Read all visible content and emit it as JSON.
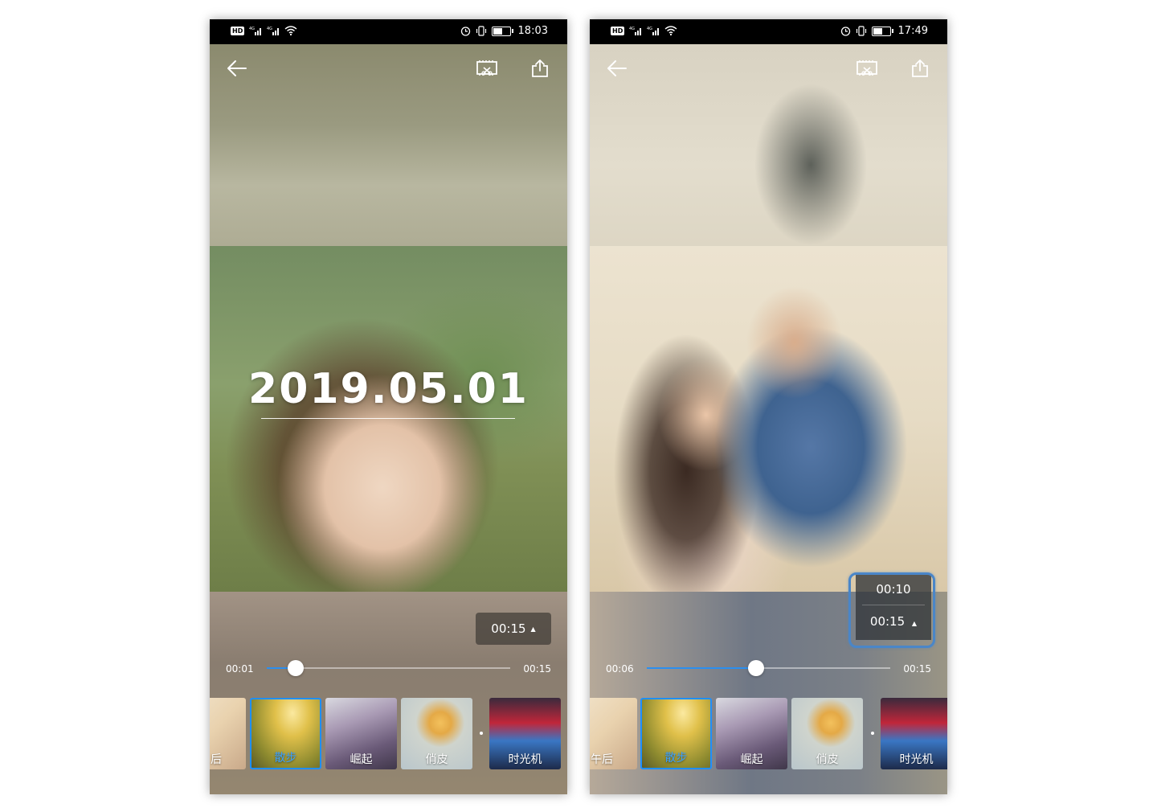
{
  "screens": [
    {
      "status": {
        "time": "18:03"
      },
      "date_title": "2019.05.01",
      "duration_button": {
        "label": "00:15",
        "arrow": "▲"
      },
      "player": {
        "current": "00:01",
        "total": "00:15",
        "progress": 0.12
      },
      "filters": [
        {
          "label": "后",
          "selected": false
        },
        {
          "label": "散步",
          "selected": true
        },
        {
          "label": "崛起",
          "selected": false
        },
        {
          "label": "俏皮",
          "selected": false
        },
        {
          "label": "时光机",
          "selected": false
        }
      ]
    },
    {
      "status": {
        "time": "17:49"
      },
      "duration_menu": {
        "option_1": "00:10",
        "option_2": "00:15",
        "arrow": "▲"
      },
      "player": {
        "current": "00:06",
        "total": "00:15",
        "progress": 0.45
      },
      "filters": [
        {
          "label": "午后",
          "selected": false
        },
        {
          "label": "散步",
          "selected": true
        },
        {
          "label": "崛起",
          "selected": false
        },
        {
          "label": "俏皮",
          "selected": false
        },
        {
          "label": "时光机",
          "selected": false
        }
      ]
    }
  ],
  "status_icons": [
    "hd-icon",
    "signal-icon",
    "signal-icon",
    "wifi-icon",
    "alarm-icon",
    "vibrate-icon",
    "battery-icon"
  ],
  "toolbar_icons": [
    "back-arrow-icon",
    "collage-icon",
    "share-icon"
  ],
  "colors": {
    "accent": "#1e8fff",
    "highlight_ring": "#4a86c8"
  }
}
